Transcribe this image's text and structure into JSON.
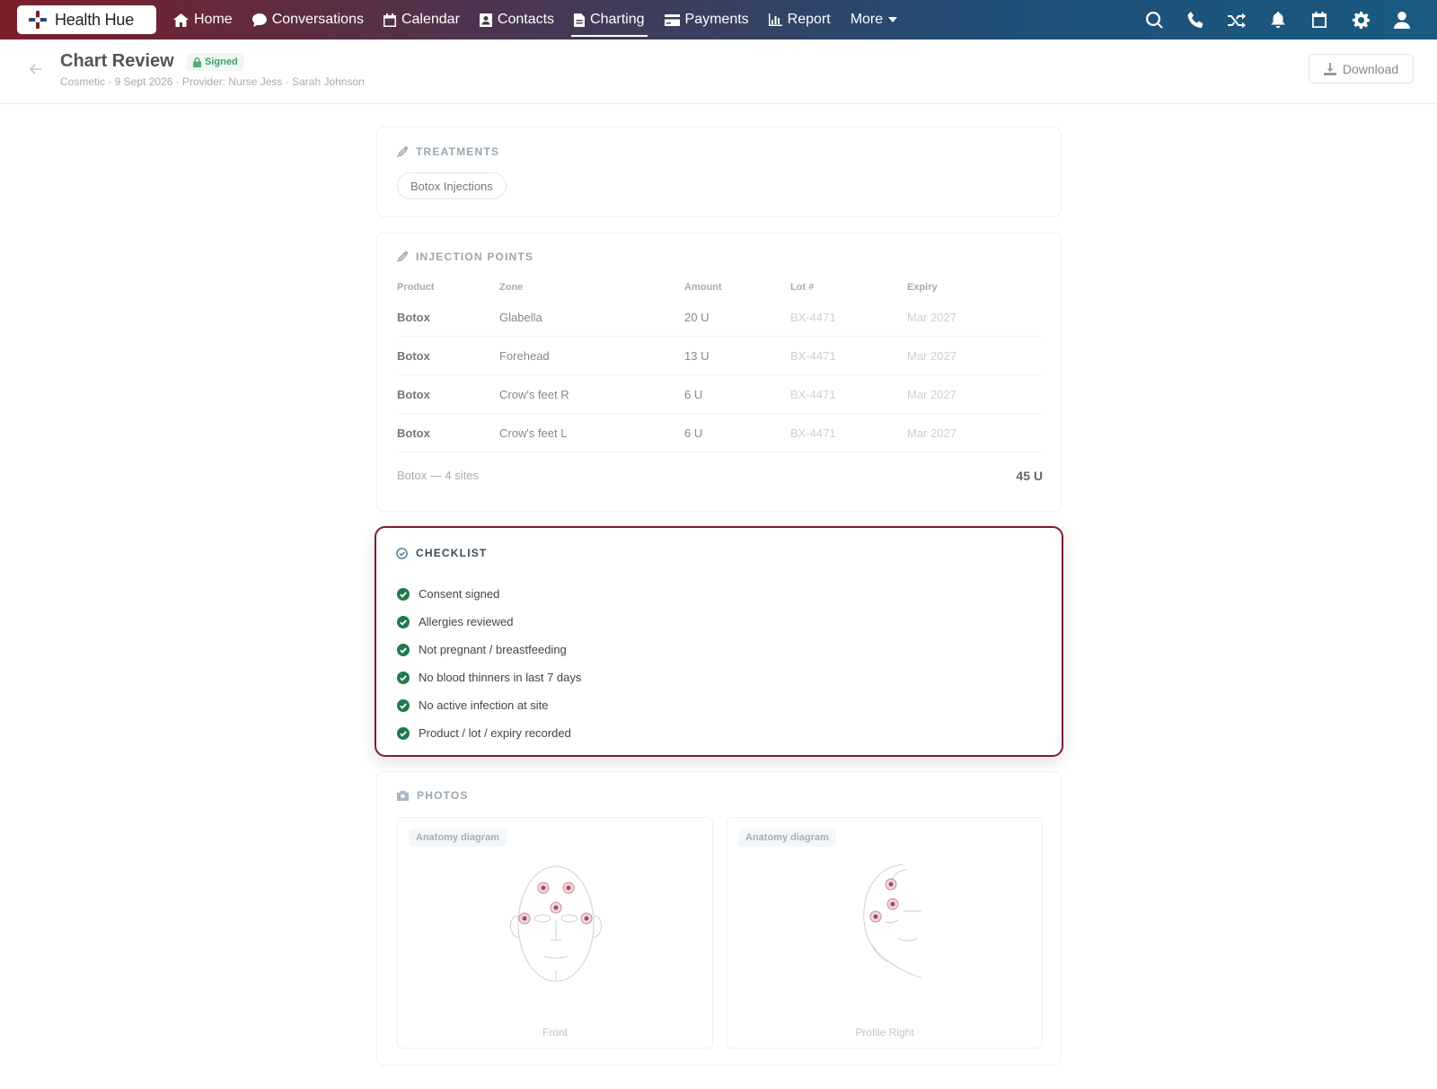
{
  "nav": {
    "brand": "Health Hue",
    "items": [
      {
        "label": "Home",
        "icon": "home-icon"
      },
      {
        "label": "Conversations",
        "icon": "chat-icon"
      },
      {
        "label": "Calendar",
        "icon": "calendar-icon"
      },
      {
        "label": "Contacts",
        "icon": "contacts-icon"
      },
      {
        "label": "Charting",
        "icon": "document-icon",
        "active": true
      },
      {
        "label": "Payments",
        "icon": "credit-card-icon"
      },
      {
        "label": "Report",
        "icon": "bar-chart-icon"
      },
      {
        "label": "More",
        "icon": "caret-down-icon"
      }
    ],
    "right_icons": [
      "search-icon",
      "phone-icon",
      "shuffle-icon",
      "bell-icon",
      "calendar-icon",
      "gear-icon",
      "user-icon"
    ],
    "gradient_colors": [
      "#7a1f2b",
      "#1a5a82"
    ]
  },
  "header": {
    "title": "Chart Review",
    "status": "Signed",
    "subtitle": "Cosmetic · 9 Sept 2026 · Provider: Nurse Jess · Sarah Johnson",
    "download_label": "Download"
  },
  "treatments": {
    "title": "TREATMENTS",
    "chips": [
      "Botox Injections"
    ]
  },
  "injections": {
    "title": "INJECTION POINTS",
    "columns": [
      "Product",
      "Zone",
      "Amount",
      "Lot #",
      "Expiry"
    ],
    "rows": [
      [
        "Botox",
        "Glabella",
        "20 U",
        "BX-4471",
        "Mar 2027"
      ],
      [
        "Botox",
        "Forehead",
        "13 U",
        "BX-4471",
        "Mar 2027"
      ],
      [
        "Botox",
        "Crow's feet R",
        "6 U",
        "BX-4471",
        "Mar 2027"
      ],
      [
        "Botox",
        "Crow's feet L",
        "6 U",
        "BX-4471",
        "Mar 2027"
      ]
    ],
    "summary": "Botox — 4 sites",
    "total": "45 U"
  },
  "checklist": {
    "title": "CHECKLIST",
    "items": [
      "Consent signed",
      "Allergies reviewed",
      "Not pregnant / breastfeeding",
      "No blood thinners in last 7 days",
      "No active infection at site",
      "Product / lot / expiry recorded"
    ],
    "accent_color": "#7a1f2b",
    "check_color": "#1e7a4c"
  },
  "photos": {
    "title": "PHOTOS",
    "items": [
      {
        "tag": "Anatomy diagram",
        "caption": "Front"
      },
      {
        "tag": "Anatomy diagram",
        "caption": "Profile Right"
      }
    ]
  }
}
